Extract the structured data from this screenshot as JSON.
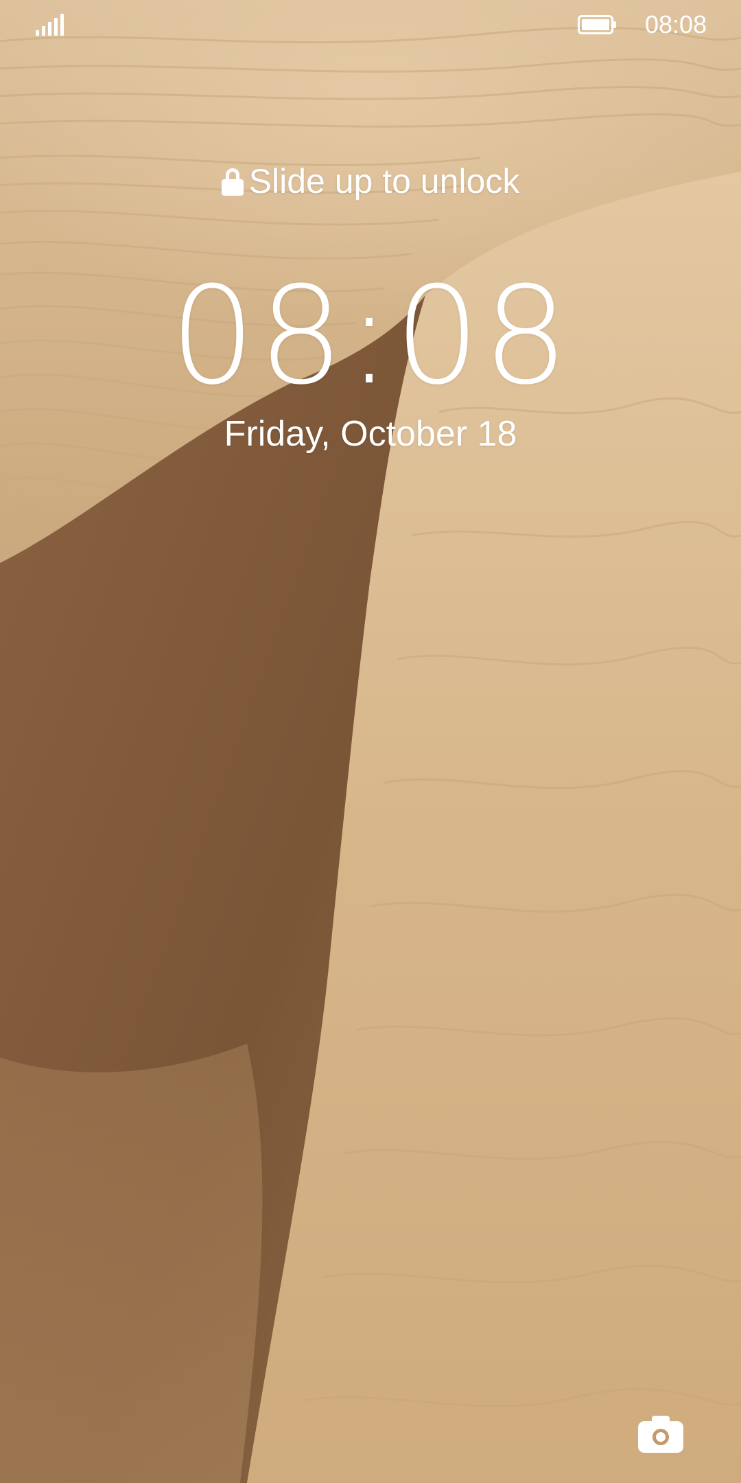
{
  "status_bar": {
    "time": "08:08",
    "signal_icon": "signal-bars-icon",
    "battery_icon": "battery-full-icon",
    "battery_level": 1.0
  },
  "lock_screen": {
    "unlock_hint": "Slide up to unlock",
    "lock_icon": "lock-icon",
    "clock": "08:08",
    "date": "Friday, October 18"
  },
  "shortcuts": {
    "camera_icon": "camera-icon"
  },
  "colors": {
    "text": "#ffffff",
    "sand_light": "#dcc19c",
    "sand_shadow": "#7a5334"
  }
}
